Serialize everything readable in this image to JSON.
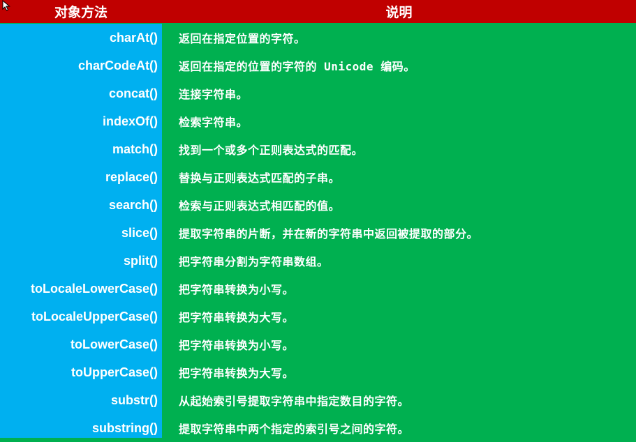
{
  "header": {
    "method_label": "对象方法",
    "description_label": "说明"
  },
  "colors": {
    "header_bg": "#c00000",
    "method_col_bg": "#00b0f0",
    "desc_col_bg": "#00b050",
    "text": "#ffffff"
  },
  "rows": [
    {
      "method": "charAt()",
      "description": "返回在指定位置的字符。"
    },
    {
      "method": "charCodeAt()",
      "description": "返回在指定的位置的字符的 Unicode 编码。"
    },
    {
      "method": "concat()",
      "description": "连接字符串。"
    },
    {
      "method": "indexOf()",
      "description": "检索字符串。"
    },
    {
      "method": "match()",
      "description": "找到一个或多个正则表达式的匹配。"
    },
    {
      "method": "replace()",
      "description": "替换与正则表达式匹配的子串。"
    },
    {
      "method": "search()",
      "description": "检索与正则表达式相匹配的值。"
    },
    {
      "method": "slice()",
      "description": "提取字符串的片断，并在新的字符串中返回被提取的部分。"
    },
    {
      "method": "split()",
      "description": "把字符串分割为字符串数组。"
    },
    {
      "method": "toLocaleLowerCase()",
      "description": "把字符串转换为小写。"
    },
    {
      "method": "toLocaleUpperCase()",
      "description": "把字符串转换为大写。"
    },
    {
      "method": "toLowerCase()",
      "description": "把字符串转换为小写。"
    },
    {
      "method": "toUpperCase()",
      "description": "把字符串转换为大写。"
    },
    {
      "method": "substr()",
      "description": "从起始索引号提取字符串中指定数目的字符。"
    },
    {
      "method": "substring()",
      "description": "提取字符串中两个指定的索引号之间的字符。"
    }
  ]
}
